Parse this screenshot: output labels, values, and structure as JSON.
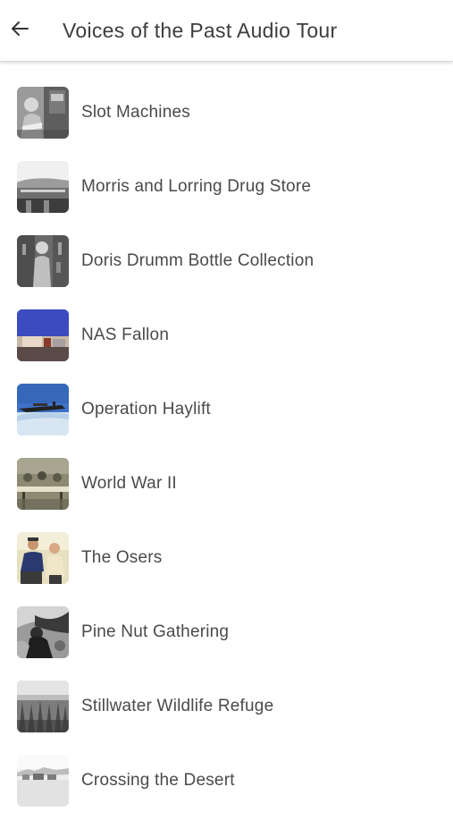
{
  "header": {
    "title": "Voices of the Past Audio Tour",
    "back_icon": "arrow-left-icon"
  },
  "stops": [
    {
      "label": "Slot Machines",
      "thumb": "photo-slot-machines"
    },
    {
      "label": "Morris and Lorring Drug Store",
      "thumb": "photo-drug-store"
    },
    {
      "label": "Doris Drumm Bottle Collection",
      "thumb": "photo-bottle-collection"
    },
    {
      "label": "NAS Fallon",
      "thumb": "photo-nas-fallon"
    },
    {
      "label": "Operation Haylift",
      "thumb": "photo-operation-haylift"
    },
    {
      "label": "World War II",
      "thumb": "photo-world-war-ii"
    },
    {
      "label": "The Osers",
      "thumb": "photo-the-osers"
    },
    {
      "label": "Pine Nut Gathering",
      "thumb": "photo-pine-nut-gathering"
    },
    {
      "label": "Stillwater Wildlife Refuge",
      "thumb": "photo-stillwater-refuge"
    },
    {
      "label": "Crossing the Desert",
      "thumb": "photo-crossing-desert"
    }
  ]
}
